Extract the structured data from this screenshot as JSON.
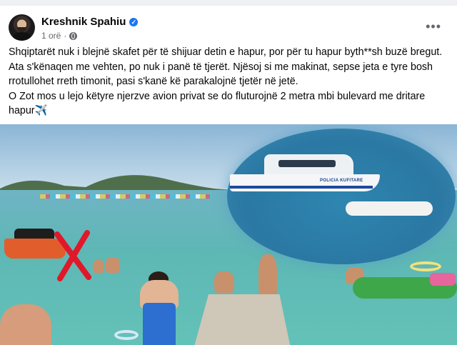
{
  "post": {
    "author": "Kreshnik Spahiu",
    "verified_badge": "verified-badge-icon",
    "time": "1 orë",
    "audience_icon": "globe-icon",
    "more_icon": "more-options-icon",
    "text_lines": [
      "Shqiptarët nuk i blejnë skafet për të shijuar detin e hapur, por për tu hapur byth**sh buzë bregut. Ata s'kënaqen me vehten, po nuk i panë të tjerët. Njësoj si me makinat, sepse jeta e tyre bosh rrotullohet rreth timonit, pasi s'kanë kë parakalojnë tjetër në jetë.",
      "O Zot mos u lejo këtyre njerzve avion privat se do fluturojnë 2 metra mbi bulevard me dritare hapur"
    ],
    "emoji": "✈️"
  },
  "photo": {
    "boat_label": "POLICIA KUFITARE"
  },
  "colors": {
    "verified": "#1877f2",
    "cross_mark": "#e0182a"
  }
}
